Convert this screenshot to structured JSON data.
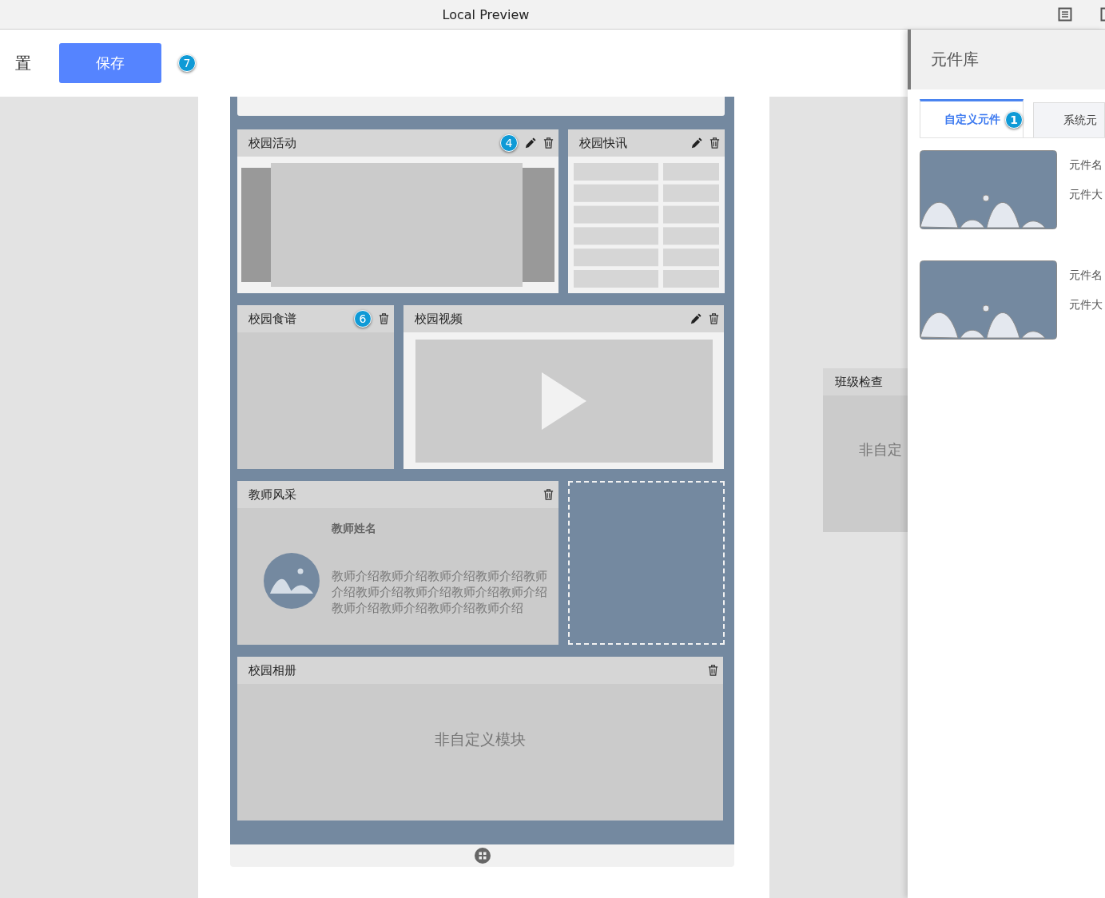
{
  "window": {
    "title": "Local Preview"
  },
  "toolbar": {
    "label": "置",
    "save_button": "保存",
    "badge": "7"
  },
  "canvas": {
    "modules": [
      {
        "title": "校园活动",
        "kind": "carousel",
        "editable": true,
        "badge": "4"
      },
      {
        "title": "校园快讯",
        "kind": "table",
        "editable": true
      },
      {
        "title": "校园食谱",
        "kind": "blank",
        "editable": false,
        "badge": "6"
      },
      {
        "title": "校园视频",
        "kind": "video",
        "editable": true
      },
      {
        "title": "教师风采",
        "kind": "teacher",
        "editable": false,
        "teacher_name": "教师姓名",
        "intro": "教师介绍教师介绍教师介绍教师介绍教师介绍教师介绍教师介绍教师介绍教师介绍教师介绍教师介绍教师介绍教师介绍"
      },
      {
        "kind": "placeholder"
      },
      {
        "title": "校园相册",
        "kind": "note",
        "editable": false,
        "note": "非自定义模块"
      }
    ]
  },
  "floating_module": {
    "title": "班级检查",
    "note": "非自定"
  },
  "library": {
    "title": "元件库",
    "tabs": [
      {
        "label": "自定义元件",
        "selected": true,
        "badge": "1"
      },
      {
        "label": "系统元",
        "selected": false
      }
    ],
    "items": [
      {
        "name": "元件名",
        "size": "元件大"
      },
      {
        "name": "元件名",
        "size": "元件大"
      }
    ]
  }
}
